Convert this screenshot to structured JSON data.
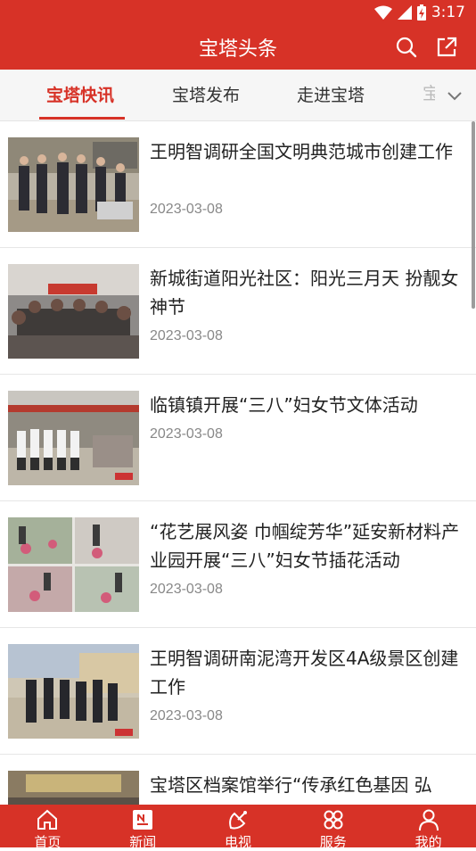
{
  "status_bar": {
    "time": "3:17"
  },
  "header": {
    "title": "宝塔头条",
    "search_icon": "search-icon",
    "share_icon": "share-icon"
  },
  "tabs": [
    {
      "label": "宝塔快讯",
      "active": true
    },
    {
      "label": "宝塔发布",
      "active": false
    },
    {
      "label": "走进宝塔",
      "active": false
    },
    {
      "label": "宝",
      "active": false
    }
  ],
  "articles": [
    {
      "title": "王明智调研全国文明典范城市创建工作",
      "date": "2023-03-08"
    },
    {
      "title": "新城街道阳光社区：阳光三月天 扮靓女神节",
      "date": "2023-03-08"
    },
    {
      "title": "临镇镇开展“三八”妇女节文体活动",
      "date": "2023-03-08"
    },
    {
      "title": "“花艺展风姿 巾帼绽芳华”延安新材料产业园开展“三八”妇女节插花活动",
      "date": "2023-03-08"
    },
    {
      "title": "王明智调研南泥湾开发区4A级景区创建工作",
      "date": "2023-03-08"
    },
    {
      "title": "宝塔区档案馆举行“传承红色基因 弘",
      "date": ""
    }
  ],
  "bottom_nav": [
    {
      "label": "首页",
      "icon": "home-icon"
    },
    {
      "label": "新闻",
      "icon": "news-icon",
      "active": true
    },
    {
      "label": "电视",
      "icon": "tv-icon"
    },
    {
      "label": "服务",
      "icon": "service-icon"
    },
    {
      "label": "我的",
      "icon": "profile-icon"
    }
  ],
  "colors": {
    "brand": "#d73227",
    "tab_bg": "#f6f6f6",
    "date_text": "#888888"
  }
}
